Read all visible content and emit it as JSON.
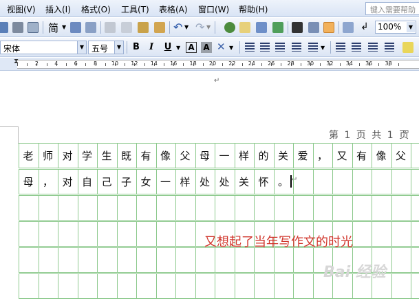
{
  "menu": {
    "items": [
      "视图(V)",
      "插入(I)",
      "格式(O)",
      "工具(T)",
      "表格(A)",
      "窗口(W)",
      "帮助(H)"
    ],
    "help_placeholder": "键入需要帮助"
  },
  "toolbar": {
    "jian_label": "简",
    "zoom_value": "100%"
  },
  "format_bar": {
    "font_name": "宋体",
    "font_size": "五号",
    "bold": "B",
    "italic": "I",
    "underline": "U",
    "char_border": "A",
    "char_shading": "A"
  },
  "ruler": {
    "numbers": [
      "2",
      "4",
      "6",
      "8",
      "10",
      "12",
      "14",
      "16",
      "18",
      "20",
      "22",
      "24",
      "26",
      "28",
      "30",
      "32",
      "34",
      "36",
      "38"
    ]
  },
  "document": {
    "page_info": "第 1 页 共 1 页",
    "paragraph_mark": "↵",
    "line1": [
      "老",
      "师",
      "对",
      "学",
      "生",
      "既",
      "有",
      "像",
      "父",
      "母",
      "一",
      "样",
      "的",
      "关",
      "爱",
      "，",
      "又",
      "有",
      "像",
      "父"
    ],
    "line2": [
      "母",
      "，",
      "对",
      "自",
      "己",
      "子",
      "女",
      "一",
      "样",
      "处",
      "处",
      "关",
      "怀",
      "。"
    ],
    "annotation": "又想起了当年写作文的时光",
    "watermark": "Bai 经验"
  },
  "colors": {
    "grid_line": "#8cc98c",
    "annotation": "#d0352b",
    "toolbar_bg": "#dbe5f4"
  }
}
